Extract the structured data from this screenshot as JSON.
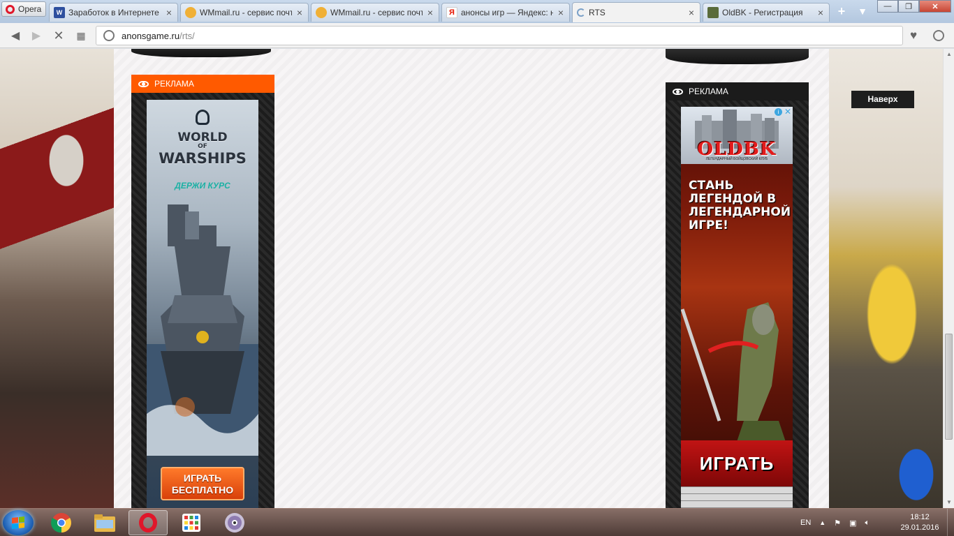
{
  "browser": {
    "menu_label": "Opera",
    "tabs": [
      {
        "title": "Заработок в Интернете",
        "favicon": "wmzona-icon",
        "color": "#2e4f9e"
      },
      {
        "title": "WMmail.ru - сервис почтовых рассылок",
        "favicon": "wmmail-icon",
        "color": "#f0b036"
      },
      {
        "title": "WMmail.ru - сервис почтовых рассылок",
        "favicon": "wmmail-icon",
        "color": "#f0b036"
      },
      {
        "title": "анонсы игр — Яндекс: нашлось",
        "favicon": "yandex-icon",
        "color": "#e61400"
      },
      {
        "title": "RTS",
        "favicon": "loading-icon",
        "color": "#7aa0c8"
      },
      {
        "title": "OldBK - Регистрация",
        "favicon": "oldbk-icon",
        "color": "#5a6b3a"
      }
    ],
    "active_tab": 4,
    "url_host": "anonsgame.ru",
    "url_path": "/rts/"
  },
  "page": {
    "left_ad": {
      "header": "РЕКЛАМА",
      "header_color": "#ff5a00",
      "brand_line1": "WORLD",
      "brand_line2": "OF",
      "brand_line3": "WARSHIPS",
      "slogan": "ДЕРЖИ КУРС",
      "cta": "ИГРАТЬ БЕСПЛАТНО"
    },
    "right_ad": {
      "header": "РЕКЛАМА",
      "logo": "OLDBK",
      "sublogo": "ЛЕГЕНДАРНЫЙ БОЙЦОВСКИЙ КЛУБ",
      "headline": "СТАНЬ ЛЕГЕНДОЙ В ЛЕГЕНДАРНОЙ ИГРЕ!",
      "cta": "ИГРАТЬ"
    },
    "scroll_top_button": "Наверх"
  },
  "taskbar": {
    "language": "EN",
    "time": "18:12",
    "date": "29.01.2016",
    "apps": [
      "windows-explorer",
      "chrome",
      "file-manager",
      "opera",
      "app-grid",
      "media-player"
    ]
  }
}
